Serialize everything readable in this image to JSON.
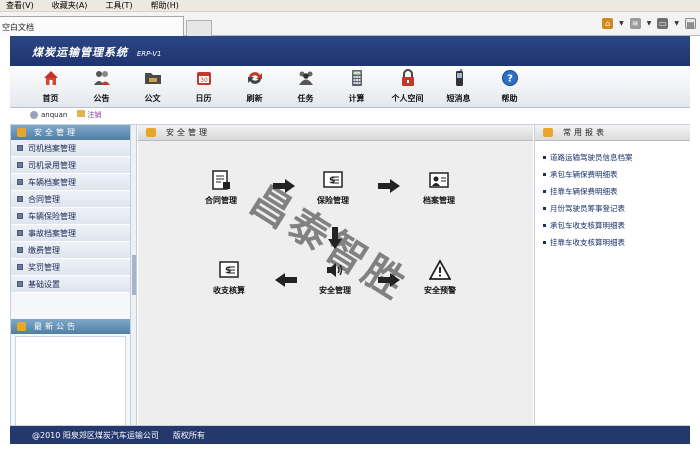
{
  "browser": {
    "menu": [
      "查看(V)",
      "收藏夹(A)",
      "工具(T)",
      "帮助(H)"
    ],
    "tab_title": "空白文档"
  },
  "app": {
    "title": "煤炭运输管理系统",
    "subtitle": "ERP-V1"
  },
  "nav": [
    {
      "label": "首页",
      "icon": "home-icon"
    },
    {
      "label": "公告",
      "icon": "users-icon"
    },
    {
      "label": "公文",
      "icon": "folder-icon"
    },
    {
      "label": "日历",
      "icon": "calendar-icon"
    },
    {
      "label": "刷新",
      "icon": "refresh-icon"
    },
    {
      "label": "任务",
      "icon": "group-icon"
    },
    {
      "label": "计算",
      "icon": "calculator-icon"
    },
    {
      "label": "个人空间",
      "icon": "lock-icon"
    },
    {
      "label": "短消息",
      "icon": "phone-icon"
    },
    {
      "label": "帮助",
      "icon": "help-icon"
    }
  ],
  "user": {
    "name": "anquan",
    "logout": "注销"
  },
  "sidebar": {
    "header": "安全管理",
    "items": [
      "司机档案管理",
      "司机录用管理",
      "车辆档案管理",
      "合同管理",
      "车辆保险管理",
      "事故档案管理",
      "缴费管理",
      "奖罚管理",
      "基础设置"
    ],
    "notice_header": "最新公告"
  },
  "center": {
    "header": "安全管理",
    "watermark": "昌泰智胜",
    "nodes": {
      "contract": "合同管理",
      "insurance": "保险管理",
      "archive": "档案管理",
      "finance": "收支核算",
      "safety": "安全管理",
      "warning": "安全预警"
    }
  },
  "reports": {
    "header": "常用报表",
    "items": [
      "道路运输驾驶员信息档案",
      "承包车辆保费明细表",
      "挂靠车辆保费明细表",
      "月份驾驶员筹事登记表",
      "承包车收支核算明细表",
      "挂靠车收支核算明细表"
    ]
  },
  "footer": {
    "copyright": "@2010 阳泉郊区煤炭汽车运输公司",
    "rights": "版权所有"
  },
  "colors": {
    "header_blue": "#24386e",
    "sidebar_head": "#5a88ae",
    "accent_orange": "#e9a72a"
  }
}
